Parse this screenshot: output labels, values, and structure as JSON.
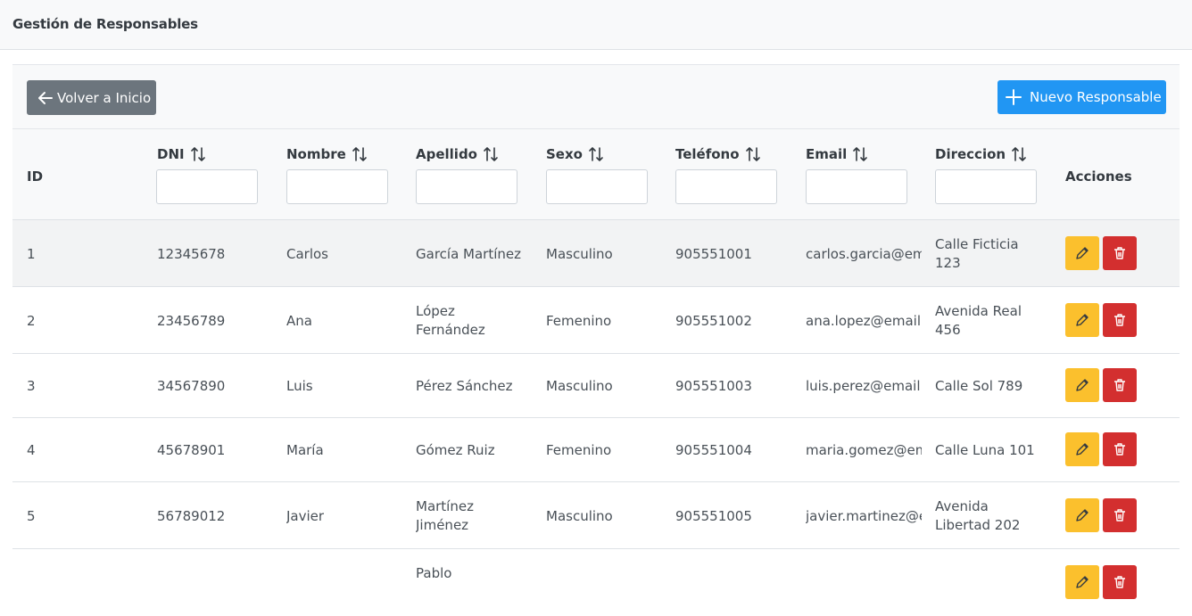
{
  "header": {
    "title": "Gestión de Responsables"
  },
  "toolbar": {
    "back_label": "Volver a Inicio",
    "new_label": "Nuevo Responsable"
  },
  "columns": {
    "id": "ID",
    "dni": "DNI",
    "nombre": "Nombre",
    "apellido": "Apellido",
    "sexo": "Sexo",
    "telefono": "Teléfono",
    "email": "Email",
    "direccion": "Direccion",
    "acciones": "Acciones"
  },
  "filters": {
    "dni": "",
    "nombre": "",
    "apellido": "",
    "sexo": "",
    "telefono": "",
    "email": "",
    "direccion": ""
  },
  "rows": [
    {
      "id": "1",
      "dni": "12345678",
      "nombre": "Carlos",
      "apellido": "García Martínez",
      "sexo": "Masculino",
      "telefono": "905551001",
      "email": "carlos.garcia@email.com",
      "direccion": "Calle Ficticia 123"
    },
    {
      "id": "2",
      "dni": "23456789",
      "nombre": "Ana",
      "apellido": "López Fernández",
      "sexo": "Femenino",
      "telefono": "905551002",
      "email": "ana.lopez@email.com",
      "direccion": "Avenida Real 456"
    },
    {
      "id": "3",
      "dni": "34567890",
      "nombre": "Luis",
      "apellido": "Pérez Sánchez",
      "sexo": "Masculino",
      "telefono": "905551003",
      "email": "luis.perez@email.com",
      "direccion": "Calle Sol 789"
    },
    {
      "id": "4",
      "dni": "45678901",
      "nombre": "María",
      "apellido": "Gómez Ruiz",
      "sexo": "Femenino",
      "telefono": "905551004",
      "email": "maria.gomez@email.com",
      "direccion": "Calle Luna 101"
    },
    {
      "id": "5",
      "dni": "56789012",
      "nombre": "Javier",
      "apellido": "Martínez Jiménez",
      "sexo": "Masculino",
      "telefono": "905551005",
      "email": "javier.martinez@email.com",
      "direccion": "Avenida Libertad 202"
    },
    {
      "id": "",
      "dni": "",
      "nombre": "",
      "apellido": "Pablo",
      "sexo": "",
      "telefono": "",
      "email": "",
      "direccion": ""
    }
  ],
  "icons": {
    "back": "arrow-left-icon",
    "new": "plus-icon",
    "sort": "sort-icon",
    "edit": "pencil-icon",
    "delete": "trash-icon"
  },
  "colors": {
    "secondary": "#6c757d",
    "primary": "#2196f3",
    "warning": "#fbc02d",
    "danger": "#d32f2f"
  }
}
